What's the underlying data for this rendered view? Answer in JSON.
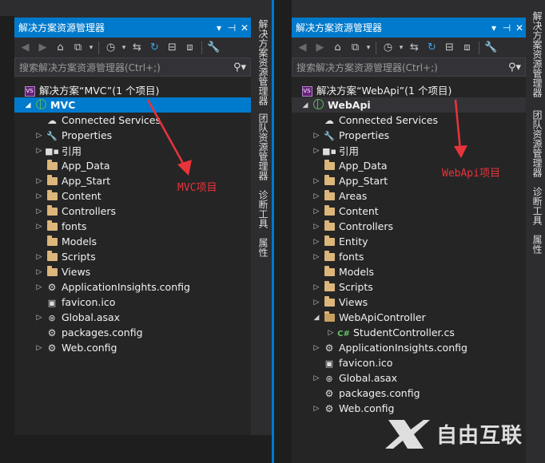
{
  "left_panel": {
    "title": "解决方案资源管理器",
    "title_controls": [
      "▾",
      "⊣",
      "✕"
    ],
    "search_placeholder": "搜索解决方案资源管理器(Ctrl+;)",
    "solution_label": "解决方案“MVC”(1 个项目)",
    "project_label": "MVC",
    "items": [
      {
        "label": "Connected Services",
        "icon": "cloud-icon",
        "expand": ""
      },
      {
        "label": "Properties",
        "icon": "wrench-icon",
        "expand": "▷"
      },
      {
        "label": "引用",
        "icon": "references-icon",
        "expand": "▷"
      },
      {
        "label": "App_Data",
        "icon": "folder-icon",
        "expand": ""
      },
      {
        "label": "App_Start",
        "icon": "folder-icon",
        "expand": "▷"
      },
      {
        "label": "Content",
        "icon": "folder-icon",
        "expand": "▷"
      },
      {
        "label": "Controllers",
        "icon": "folder-icon",
        "expand": "▷"
      },
      {
        "label": "fonts",
        "icon": "folder-icon",
        "expand": "▷"
      },
      {
        "label": "Models",
        "icon": "folder-icon",
        "expand": ""
      },
      {
        "label": "Scripts",
        "icon": "folder-icon",
        "expand": "▷"
      },
      {
        "label": "Views",
        "icon": "folder-icon",
        "expand": "▷"
      },
      {
        "label": "ApplicationInsights.config",
        "icon": "config-file-icon",
        "expand": "▷"
      },
      {
        "label": "favicon.ico",
        "icon": "image-file-icon",
        "expand": ""
      },
      {
        "label": "Global.asax",
        "icon": "asax-file-icon",
        "expand": "▷"
      },
      {
        "label": "packages.config",
        "icon": "config-file-icon",
        "expand": ""
      },
      {
        "label": "Web.config",
        "icon": "config-file-icon",
        "expand": "▷"
      }
    ],
    "side_tabs": [
      "解决方案资源管理器",
      "团队资源管理器",
      "诊断工具",
      "属性"
    ],
    "annotation": "MVC项目"
  },
  "right_panel": {
    "title": "解决方案资源管理器",
    "title_controls": [
      "▾",
      "⊣",
      "✕"
    ],
    "search_placeholder": "搜索解决方案资源管理器(Ctrl+;)",
    "solution_label": "解决方案“WebApi”(1 个项目)",
    "project_label": "WebApi",
    "items": [
      {
        "label": "Connected Services",
        "icon": "cloud-icon",
        "expand": "",
        "indent": 0
      },
      {
        "label": "Properties",
        "icon": "wrench-icon",
        "expand": "▷",
        "indent": 0
      },
      {
        "label": "引用",
        "icon": "references-icon",
        "expand": "▷",
        "indent": 0
      },
      {
        "label": "App_Data",
        "icon": "folder-icon",
        "expand": "",
        "indent": 0
      },
      {
        "label": "App_Start",
        "icon": "folder-icon",
        "expand": "▷",
        "indent": 0
      },
      {
        "label": "Areas",
        "icon": "folder-icon",
        "expand": "▷",
        "indent": 0
      },
      {
        "label": "Content",
        "icon": "folder-icon",
        "expand": "▷",
        "indent": 0
      },
      {
        "label": "Controllers",
        "icon": "folder-icon",
        "expand": "▷",
        "indent": 0
      },
      {
        "label": "Entity",
        "icon": "folder-icon",
        "expand": "▷",
        "indent": 0
      },
      {
        "label": "fonts",
        "icon": "folder-icon",
        "expand": "▷",
        "indent": 0
      },
      {
        "label": "Models",
        "icon": "folder-icon",
        "expand": "",
        "indent": 0
      },
      {
        "label": "Scripts",
        "icon": "folder-icon",
        "expand": "▷",
        "indent": 0
      },
      {
        "label": "Views",
        "icon": "folder-icon",
        "expand": "▷",
        "indent": 0
      },
      {
        "label": "WebApiController",
        "icon": "folder-open-icon",
        "expand": "◢",
        "indent": 0
      },
      {
        "label": "StudentController.cs",
        "icon": "csharp-file-icon",
        "expand": "▷",
        "indent": 1
      },
      {
        "label": "ApplicationInsights.config",
        "icon": "config-file-icon",
        "expand": "▷",
        "indent": 0
      },
      {
        "label": "favicon.ico",
        "icon": "image-file-icon",
        "expand": "",
        "indent": 0
      },
      {
        "label": "Global.asax",
        "icon": "asax-file-icon",
        "expand": "▷",
        "indent": 0
      },
      {
        "label": "packages.config",
        "icon": "config-file-icon",
        "expand": "",
        "indent": 0
      },
      {
        "label": "Web.config",
        "icon": "config-file-icon",
        "expand": "▷",
        "indent": 0
      }
    ],
    "side_tabs": [
      "解决方案资源管理器",
      "团队资源管理器",
      "诊断工具",
      "属性"
    ],
    "annotation": "WebApi项目"
  },
  "watermark": "自由互联",
  "colors": {
    "accent": "#007acc",
    "panel_bg": "#252526",
    "annotation": "#e8343a",
    "folder": "#dcb67a"
  }
}
